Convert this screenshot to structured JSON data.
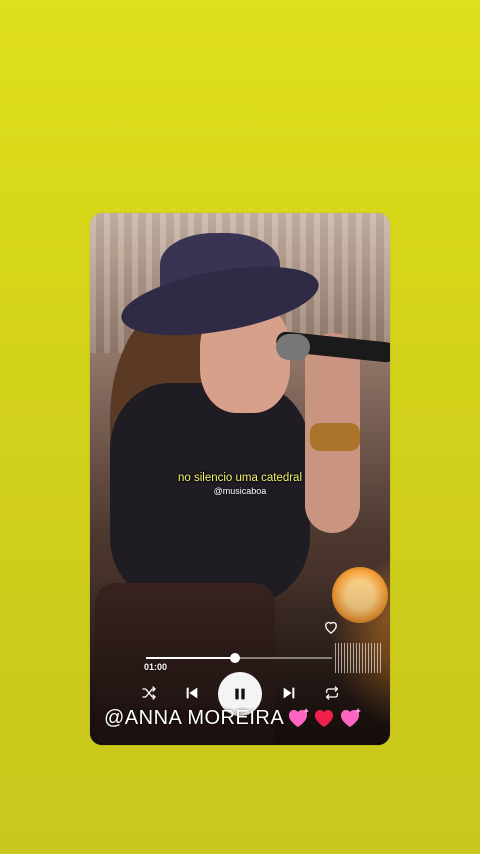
{
  "video": {
    "lyric": "no silencio uma catedral",
    "handle": "@musicaboa"
  },
  "player": {
    "current_time": "01:00",
    "progress": 0.48,
    "state": "playing"
  },
  "caption": {
    "artist": "@ANNA MOREIRA"
  },
  "colors": {
    "background": "#d6d61b",
    "lyric": "#f5f36c",
    "controls": "#ffffff"
  },
  "icons": [
    "heart-outline-icon",
    "shuffle-icon",
    "previous-icon",
    "pause-icon",
    "next-icon",
    "repeat-icon",
    "sparkling-heart-icon",
    "red-heart-icon"
  ]
}
